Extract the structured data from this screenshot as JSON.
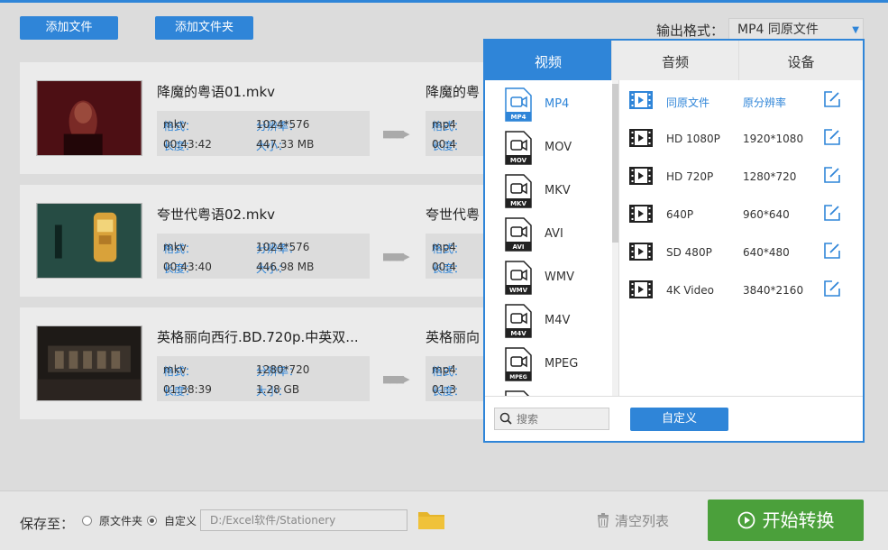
{
  "toolbar": {
    "add_file": "添加文件",
    "add_folder": "添加文件夹",
    "output_format_label": "输出格式：",
    "output_format_value": "MP4  同原文件"
  },
  "files": [
    {
      "name": "降魔的粤语01.mkv",
      "format_label": "格式：",
      "format": "mkv",
      "resolution_label": "分辨率：",
      "resolution": "1024*576",
      "duration_label": "长度：",
      "duration": "00:43:42",
      "size_label": "大小：",
      "size": "447.33 MB",
      "out_name": "降魔的粤",
      "out_format": "mp4",
      "out_duration": "00:4"
    },
    {
      "name": "夸世代粤语02.mkv",
      "format_label": "格式：",
      "format": "mkv",
      "resolution_label": "分辨率：",
      "resolution": "1024*576",
      "duration_label": "长度：",
      "duration": "00:43:40",
      "size_label": "大小：",
      "size": "446.98 MB",
      "out_name": "夸世代粤",
      "out_format": "mp4",
      "out_duration": "00:4"
    },
    {
      "name": "英格丽向西行.BD.720p.中英双...",
      "format_label": "格式：",
      "format": "mkv",
      "resolution_label": "分辨率：",
      "resolution": "1280*720",
      "duration_label": "长度：",
      "duration": "01:38:39",
      "size_label": "大小：",
      "size": "1.28 GB",
      "out_name": "英格丽向",
      "out_format": "mp4",
      "out_duration": "01:3"
    }
  ],
  "panel": {
    "tabs": [
      "视频",
      "音频",
      "设备"
    ],
    "formats": [
      {
        "label": "MP4",
        "icon_text": "MP4"
      },
      {
        "label": "MOV",
        "icon_text": "MOV"
      },
      {
        "label": "MKV",
        "icon_text": "MKV"
      },
      {
        "label": "AVI",
        "icon_text": "AVI"
      },
      {
        "label": "WMV",
        "icon_text": "WMV"
      },
      {
        "label": "M4V",
        "icon_text": "M4V"
      },
      {
        "label": "MPEG",
        "icon_text": "MPEG"
      }
    ],
    "presets": [
      {
        "name": "同原文件",
        "res": "原分辨率"
      },
      {
        "name": "HD 1080P",
        "res": "1920*1080"
      },
      {
        "name": "HD 720P",
        "res": "1280*720"
      },
      {
        "name": "640P",
        "res": "960*640"
      },
      {
        "name": "SD 480P",
        "res": "640*480"
      },
      {
        "name": "4K Video",
        "res": "3840*2160"
      }
    ],
    "search_placeholder": "搜索",
    "custom_button": "自定义"
  },
  "bottom": {
    "save_to": "保存至：",
    "opt_original": "原文件夹",
    "opt_custom": "自定义",
    "path": "D:/Excel软件/Stationery",
    "clear_list": "清空列表",
    "start": "开始转换"
  },
  "colors": {
    "accent": "#2f85d8",
    "start_green": "#4ba03b",
    "folder_yellow": "#e5b52c"
  }
}
